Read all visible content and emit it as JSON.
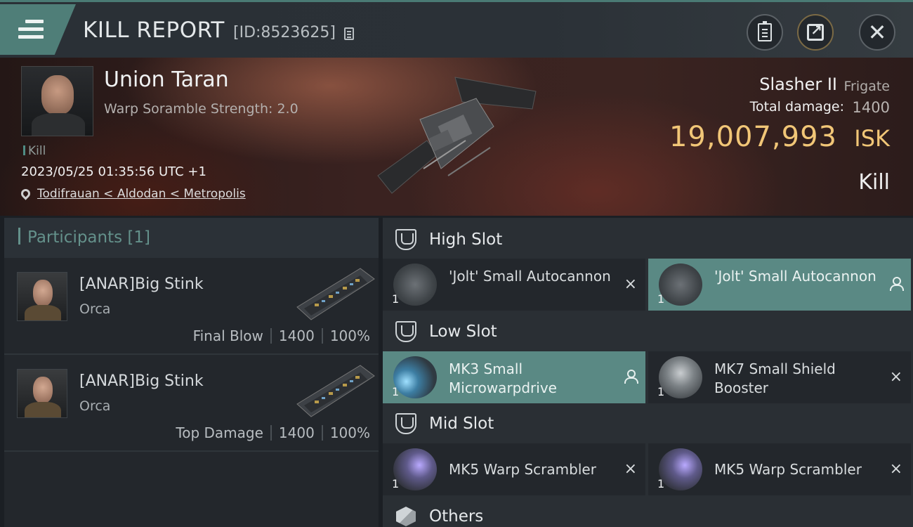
{
  "header": {
    "title": "KILL REPORT",
    "report_id": "[ID:8523625]",
    "icons": [
      "menu-icon",
      "copy-icon",
      "clipboard-icon",
      "share-icon",
      "close-icon"
    ]
  },
  "victim": {
    "name": "Union Taran",
    "subtitle": "Warp Soramble Strength: 2.0",
    "tag": "Kill",
    "timestamp": "2023/05/25 01:35:56 UTC +1",
    "location": "Todifrauan < Aldodan < Metropolis",
    "ship_name": "Slasher II",
    "ship_class": "Frigate",
    "damage_label": "Total damage:",
    "damage_value": "1400",
    "isk_value": "19,007,993",
    "isk_unit": "ISK",
    "result": "Kill"
  },
  "participants": {
    "title": "Participants",
    "count": "[1]",
    "rows": [
      {
        "name": "[ANAR]Big Stink",
        "ship": "Orca",
        "role": "Final Blow",
        "damage": "1400",
        "percent": "100%"
      },
      {
        "name": "[ANAR]Big Stink",
        "ship": "Orca",
        "role": "Top Damage",
        "damage": "1400",
        "percent": "100%"
      }
    ]
  },
  "fitting": {
    "high": {
      "title": "High Slot",
      "modules": [
        {
          "name": "'Jolt' Small Autocannon",
          "qty": "1",
          "status": "×"
        },
        {
          "name": "'Jolt' Small Autocannon",
          "qty": "1",
          "status": "person"
        }
      ]
    },
    "low": {
      "title": "Low Slot",
      "modules": [
        {
          "name": "MK3 Small Microwarpdrive",
          "qty": "1",
          "status": "person"
        },
        {
          "name": "MK7 Small Shield Booster",
          "qty": "1",
          "status": "×"
        }
      ]
    },
    "mid": {
      "title": "Mid Slot",
      "modules": [
        {
          "name": "MK5 Warp Scrambler",
          "qty": "1",
          "status": "×"
        },
        {
          "name": "MK5 Warp Scrambler",
          "qty": "1",
          "status": "×"
        }
      ]
    },
    "others": {
      "title": "Others"
    }
  },
  "colors": {
    "accent": "#5a8984",
    "isk": "#f1c677"
  }
}
